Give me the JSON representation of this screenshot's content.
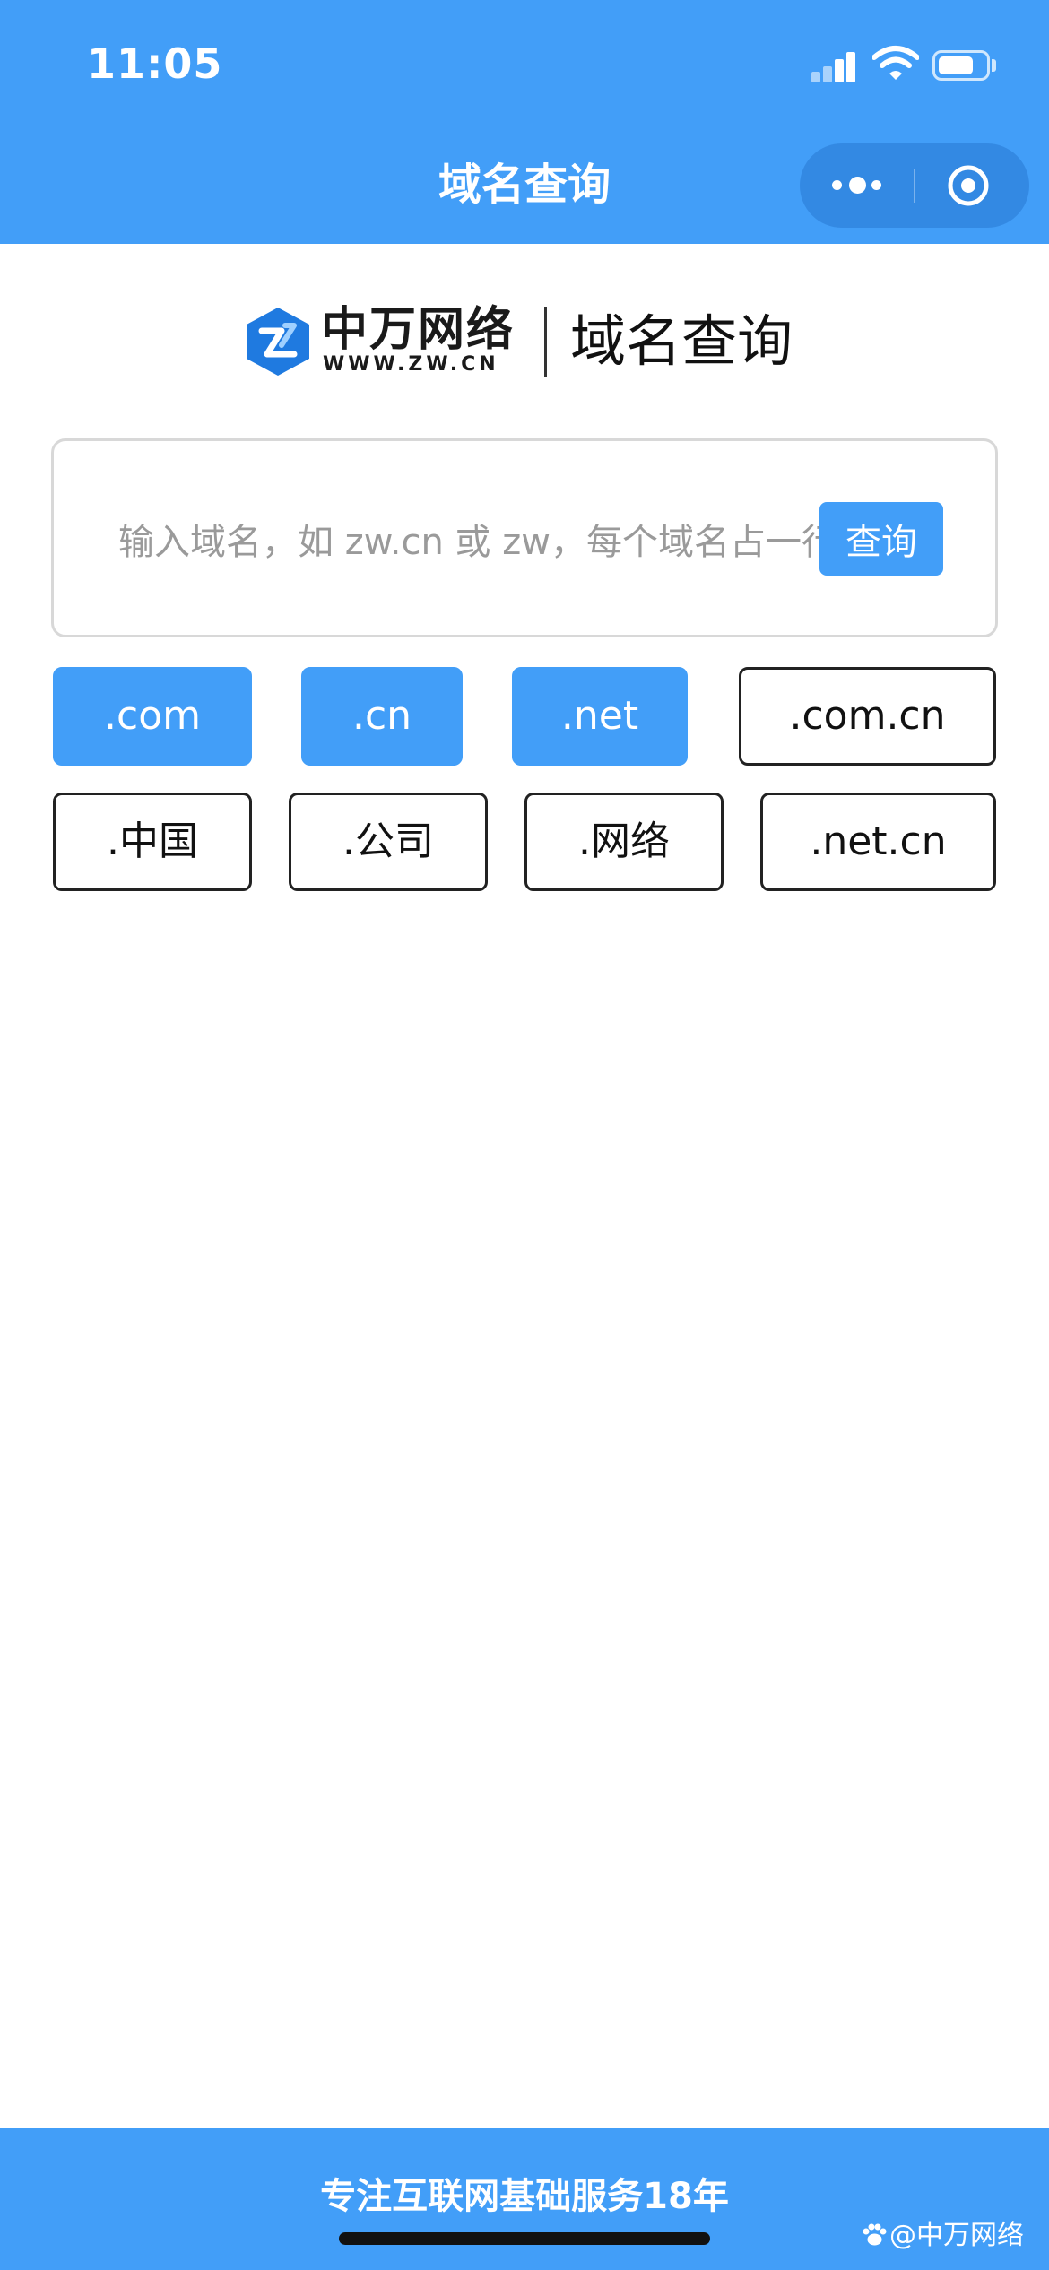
{
  "status_bar": {
    "time": "11:05"
  },
  "header": {
    "title": "域名查询"
  },
  "logo": {
    "brand": "中万网络",
    "url": "WWW.ZW.CN",
    "product": "域名查询"
  },
  "search": {
    "placeholder": "输入域名，如 zw.cn 或 zw，每个域名占一行",
    "value": "",
    "button_label": "查询"
  },
  "suffixes": [
    {
      "label": ".com",
      "selected": true
    },
    {
      "label": ".cn",
      "selected": true
    },
    {
      "label": ".net",
      "selected": true
    },
    {
      "label": ".com.cn",
      "selected": false
    },
    {
      "label": ".中国",
      "selected": false
    },
    {
      "label": ".公司",
      "selected": false
    },
    {
      "label": ".网络",
      "selected": false
    },
    {
      "label": ".net.cn",
      "selected": false
    }
  ],
  "footer": {
    "slogan": "专注互联网基础服务18年",
    "watermark": "@中万网络"
  },
  "colors": {
    "primary": "#429ef8",
    "chip_border": "#222222",
    "background": "#ffffff"
  }
}
